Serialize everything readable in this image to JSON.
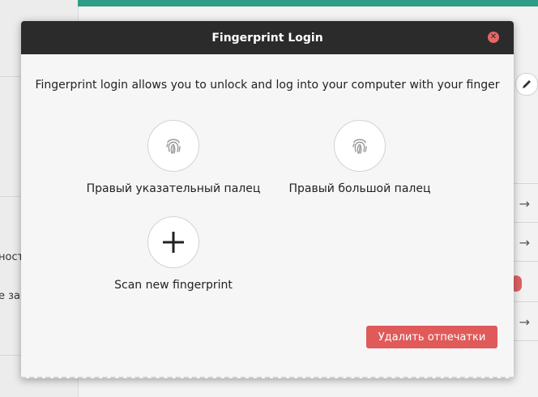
{
  "dialog": {
    "title": "Fingerprint Login",
    "description": "Fingerprint login allows you to unlock and log into your computer with your finger",
    "fingers": [
      {
        "label": "Правый указательный палец",
        "icon": "fingerprint-icon"
      },
      {
        "label": "Правый большой палец",
        "icon": "fingerprint-icon"
      }
    ],
    "scan_new": {
      "label": "Scan new fingerprint",
      "icon": "plus-icon"
    },
    "delete_label": "Удалить отпечатки",
    "close_icon": "close-icon"
  },
  "background": {
    "partial_text_1": "ност",
    "partial_text_2": "е за",
    "accent_color": "#2e9c86"
  }
}
